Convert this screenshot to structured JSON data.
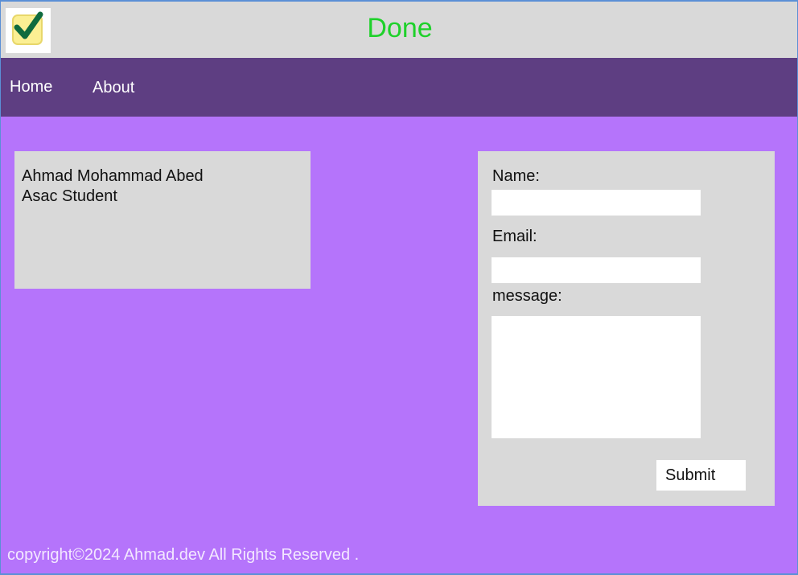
{
  "header": {
    "title": "Done",
    "title_color": "#1ed12a",
    "logo_icon": "checkmark-checkbox-icon"
  },
  "nav": {
    "items": [
      {
        "label": "Home"
      },
      {
        "label": "About"
      }
    ]
  },
  "profile_card": {
    "name": "Ahmad Mohammad Abed",
    "role": "Asac Student"
  },
  "contact_form": {
    "name_label": "Name:",
    "email_label": "Email:",
    "message_label": "message:",
    "name_value": "",
    "email_value": "",
    "message_value": "",
    "submit_label": "Submit"
  },
  "footer": {
    "text": "copyright©2024 Ahmad.dev All Rights Reserved ."
  },
  "colors": {
    "background": "#b574fb",
    "header_bg": "#d9d9d9",
    "nav_bg": "#5e3e82",
    "card_bg": "#d9d9d9"
  }
}
